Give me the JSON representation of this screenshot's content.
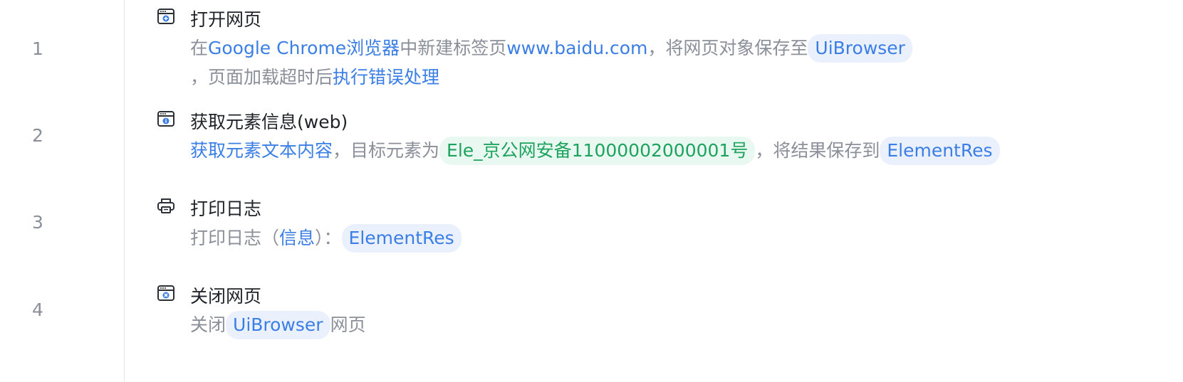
{
  "steps": [
    {
      "number": "1",
      "title": "打开网页",
      "icon": "browser-open-icon",
      "line1": {
        "t1": "在",
        "browser": "Google Chrome浏览器",
        "t2": "中新建标签页",
        "url": "www.baidu.com",
        "t3": "，将网页对象保存至",
        "var": "UiBrowser"
      },
      "line2": {
        "t1": "，页面加载超时后",
        "action": "执行错误处理"
      }
    },
    {
      "number": "2",
      "title": "获取元素信息(web)",
      "icon": "browser-info-icon",
      "line1": {
        "action": "获取元素文本内容",
        "t1": "，目标元素为",
        "element": "Ele_京公网安备11000002000001号",
        "t2": "，将结果保存到",
        "var": "ElementRes"
      }
    },
    {
      "number": "3",
      "title": "打印日志",
      "icon": "printer-icon",
      "line1": {
        "t1": "打印日志（",
        "level": "信息",
        "t2": "）：",
        "var": "ElementRes"
      }
    },
    {
      "number": "4",
      "title": "关闭网页",
      "icon": "browser-close-icon",
      "line1": {
        "t1": "关闭",
        "var": "UiBrowser",
        "t2": "网页"
      }
    }
  ],
  "colors": {
    "link": "#3a7ee6",
    "chip_bg": "#eaf1fd",
    "element_text": "#1ea35e",
    "element_bg": "#e9f8f1",
    "muted": "#8a8f99",
    "title": "#1f2329"
  }
}
